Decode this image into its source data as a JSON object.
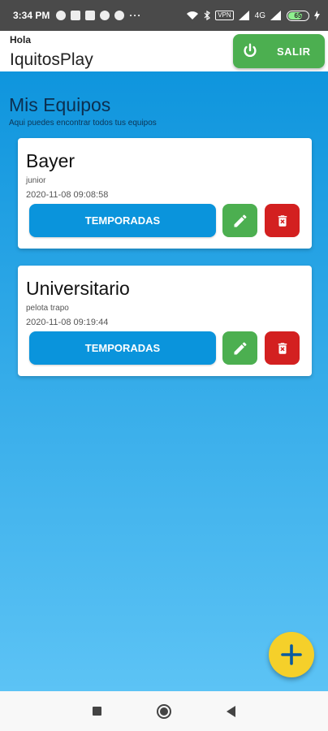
{
  "status_bar": {
    "time": "3:34 PM",
    "dots": "···",
    "vpn": "VPN",
    "network": "4G",
    "battery": "65",
    "battery_level": 0.65
  },
  "header": {
    "greeting": "Hola",
    "app_name": "IquitosPlay",
    "logout_label": "SALIR",
    "logout_color": "#4caf50"
  },
  "main": {
    "title": "Mis Equipos",
    "subtitle": "Aqui puedes encontrar todos tus equipos",
    "gradient_top": "#0f95dd",
    "gradient_bottom": "#5cc3f5"
  },
  "teams": [
    {
      "name": "Bayer",
      "category": "junior",
      "date": "2020-11-08 09:08:58",
      "seasons_label": "TEMPORADAS"
    },
    {
      "name": "Universitario",
      "category": "pelota trapo",
      "date": "2020-11-08 09:19:44",
      "seasons_label": "TEMPORADAS"
    }
  ],
  "icons": {
    "logout": "power-icon",
    "edit": "pencil-icon",
    "delete": "trash-icon",
    "add": "plus-icon"
  },
  "colors": {
    "primary": "#0a94dc",
    "edit": "#4caf50",
    "delete": "#d32020",
    "fab": "#f5d02a"
  }
}
